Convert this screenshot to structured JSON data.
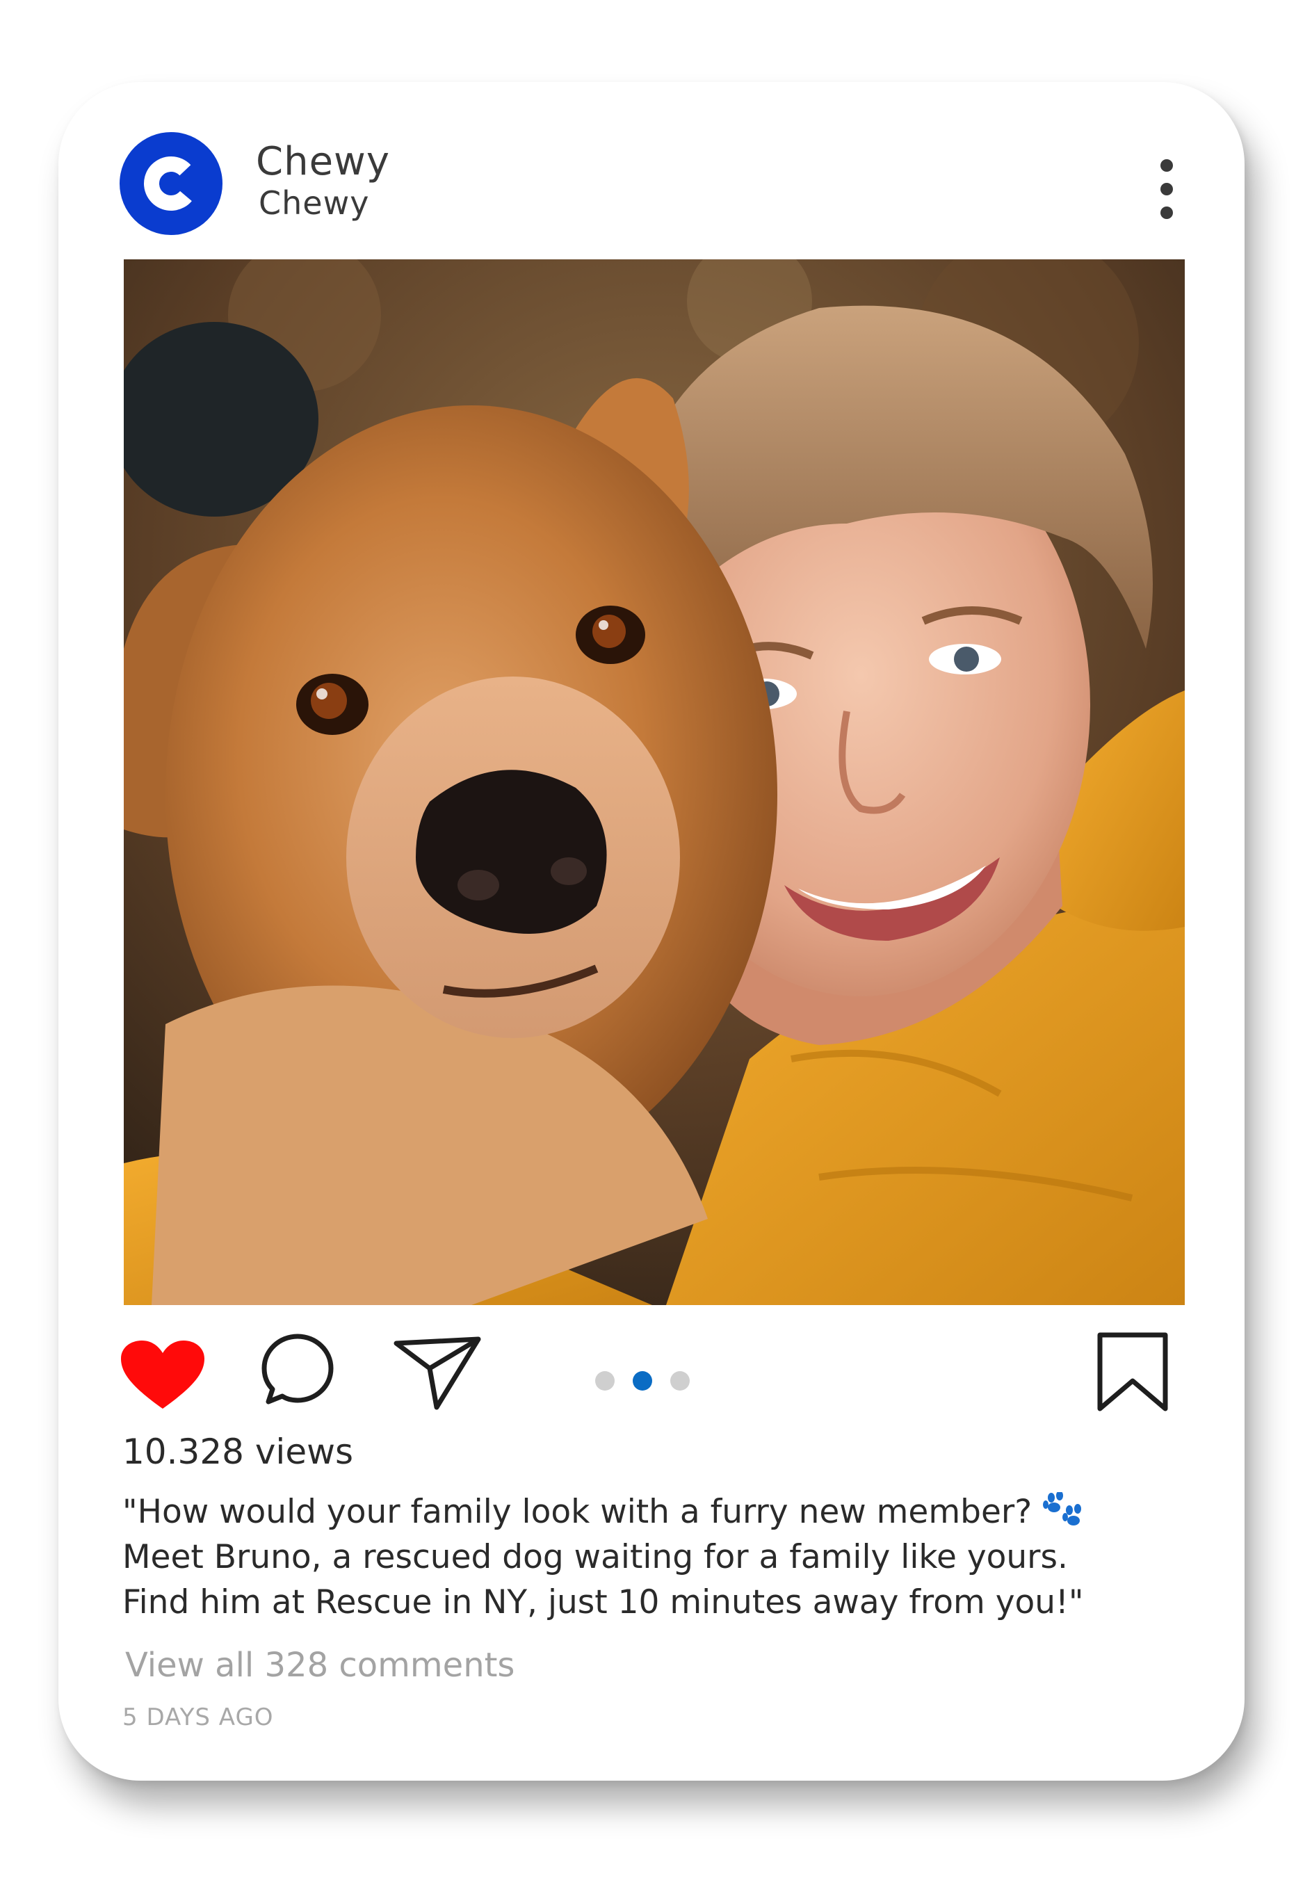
{
  "account": {
    "name": "Chewy",
    "handle": "Chewy",
    "avatar_letter": "C",
    "avatar_color": "#0a3ccf"
  },
  "header": {
    "more_icon": "more-vertical-icon"
  },
  "post": {
    "image_alt": "Golden dog and smiling boy in a yellow jacket, cheek to cheek",
    "actions": {
      "like_icon": "heart-filled-icon",
      "like_color": "#ff0a0a",
      "comment_icon": "comment-bubble-icon",
      "share_icon": "send-icon",
      "save_icon": "bookmark-icon"
    },
    "carousel": {
      "count": 3,
      "active_index": 1,
      "active_color": "#0a6cc4"
    },
    "views": "10.328 views",
    "caption_lines": [
      "\"How would your family look with a furry new member?",
      "Meet Bruno, a rescued dog waiting for a family like yours.",
      "Find him at Rescue in NY, just 10 minutes away from you!\""
    ],
    "caption_icon": "paw-prints-icon",
    "view_comments": "View all 328 comments",
    "timestamp": "5 DAYS AGO"
  }
}
